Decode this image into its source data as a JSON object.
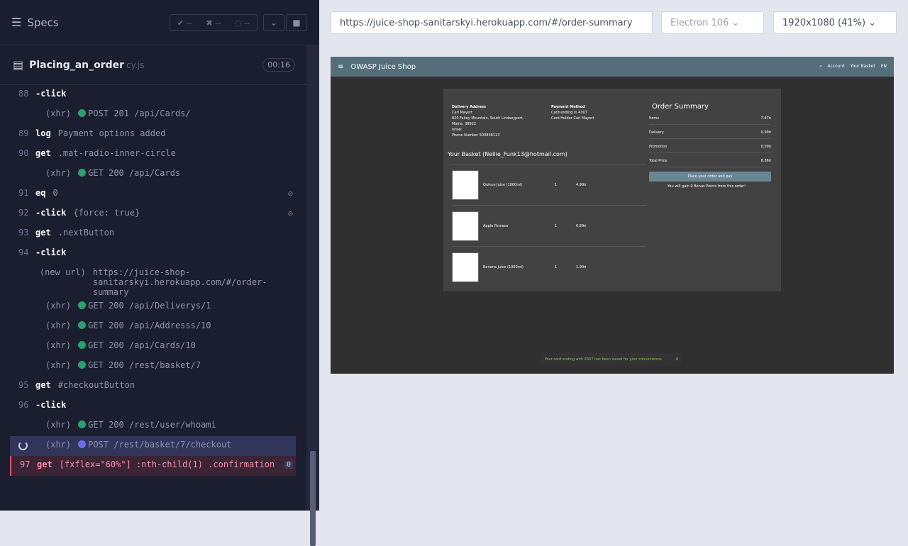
{
  "reporter": {
    "specs_label": "Specs",
    "stats": {
      "passed": "--",
      "failed": "--",
      "pending": "--"
    },
    "file": {
      "name": "Placing_an_order",
      "ext": "cy.js",
      "time": "00:16"
    }
  },
  "commands": [
    {
      "num": "88",
      "name": "-click",
      "msg": ""
    },
    {
      "num": "",
      "name": "(xhr)",
      "msg": "POST 201 /api/Cards/",
      "dot": true
    },
    {
      "num": "89",
      "name": "log",
      "msg": "Payment options added"
    },
    {
      "num": "90",
      "name": "get",
      "msg": ".mat-radio-inner-circle"
    },
    {
      "num": "",
      "name": "(xhr)",
      "msg": "GET 200 /api/Cards",
      "dot": true
    },
    {
      "num": "91",
      "name": "eq",
      "msg": "0",
      "eye": true
    },
    {
      "num": "92",
      "name": "-click",
      "msg": "{force: true}",
      "eye": true
    },
    {
      "num": "93",
      "name": "get",
      "msg": ".nextButton"
    },
    {
      "num": "94",
      "name": "-click",
      "msg": ""
    },
    {
      "num": "",
      "name": "(new url)",
      "msg": "https://juice-shop-sanitarskyi.herokuapp.com/#/order-summary"
    },
    {
      "num": "",
      "name": "(xhr)",
      "msg": "GET 200 /api/Deliverys/1",
      "dot": true
    },
    {
      "num": "",
      "name": "(xhr)",
      "msg": "GET 200 /api/Addresss/10",
      "dot": true
    },
    {
      "num": "",
      "name": "(xhr)",
      "msg": "GET 200 /api/Cards/10",
      "dot": true
    },
    {
      "num": "",
      "name": "(xhr)",
      "msg": "GET 200 /rest/basket/7",
      "dot": true
    },
    {
      "num": "95",
      "name": "get",
      "msg": "#checkoutButton"
    },
    {
      "num": "96",
      "name": "-click",
      "msg": ""
    },
    {
      "num": "",
      "name": "(xhr)",
      "msg": "GET 200 /rest/user/whoami",
      "dot": true
    },
    {
      "num": "",
      "name": "(xhr)",
      "msg": "POST /rest/basket/7/checkout",
      "dot": true,
      "pending": true
    },
    {
      "num": "97",
      "name": "get",
      "msg": "[fxflex=\"60%\"] :nth-child(1) .confirmation",
      "failed": true,
      "badge": "0"
    }
  ],
  "browser_bar": {
    "url": "https://juice-shop-sanitarskyi.herokuapp.com/#/order-summary",
    "browser": "Electron 106",
    "viewport": "1920x1080",
    "zoom": "(41%)"
  },
  "app": {
    "title": "OWASP Juice Shop",
    "nav": {
      "account": "Account",
      "basket": "Your Basket",
      "lang": "EN"
    },
    "delivery_label": "Delivery Address",
    "delivery_name": "Carl Mayert",
    "delivery_line1": "820 Fahey Mountain, South Lindseyport,",
    "delivery_line2": "Maine, 38922",
    "delivery_country": "Israel",
    "delivery_phone": "Phone Number 500838113",
    "payment_label": "Payment Method",
    "payment_card": "Card ending in 4307",
    "payment_holder": "Card Holder Carl Mayert",
    "basket_title": "Your Basket (Nellie_Funk13@hotmail.com)",
    "items": [
      {
        "name": "Quince Juice (1000ml)",
        "qty": "1",
        "price": "4.99¤"
      },
      {
        "name": "Apple Pomace",
        "qty": "1",
        "price": "0.89¤"
      },
      {
        "name": "Banana Juice (1000ml)",
        "qty": "1",
        "price": "1.99¤"
      }
    ],
    "summary_title": "Order Summary",
    "summary_rows": [
      {
        "label": "Items",
        "value": "7.87¤"
      },
      {
        "label": "Delivery",
        "value": "0.99¤"
      },
      {
        "label": "Promotion",
        "value": "0.00¤"
      },
      {
        "label": "Total Price",
        "value": "8.86¤"
      }
    ],
    "place_order": "Place your order and pay",
    "bonus": "You will gain 0 Bonus Points from this order!",
    "toast": "Your card ending with 4307 has been saved for your convenience.",
    "toast_close": "X"
  }
}
